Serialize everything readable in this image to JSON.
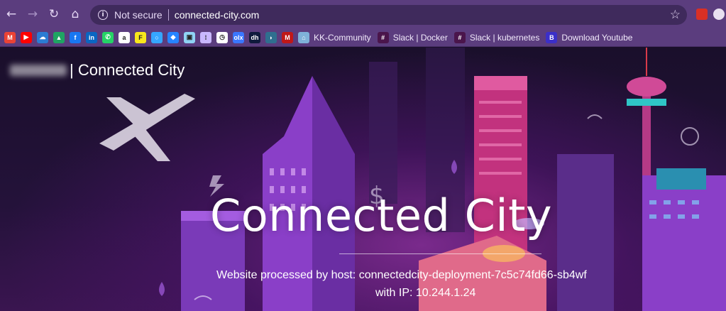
{
  "browser": {
    "back_glyph": "←",
    "forward_glyph": "→",
    "reload_glyph": "↻",
    "home_glyph": "⌂",
    "info_glyph": "i",
    "security_label": "Not secure",
    "url": "connected-city.com",
    "star_glyph": "☆",
    "accent_color": "#5b3d7e"
  },
  "bookmarks": {
    "icons": [
      {
        "name": "gmail-icon",
        "color": "#ea4335",
        "glyph": "M"
      },
      {
        "name": "youtube-icon",
        "color": "#ff0000",
        "glyph": "▶"
      },
      {
        "name": "onedrive-icon",
        "color": "#2b7cd3",
        "glyph": "☁"
      },
      {
        "name": "google-drive-icon",
        "color": "#1fa463",
        "glyph": "▲"
      },
      {
        "name": "facebook-icon",
        "color": "#1877f2",
        "glyph": "f"
      },
      {
        "name": "linkedin-icon",
        "color": "#0a66c2",
        "glyph": "in"
      },
      {
        "name": "whatsapp-icon",
        "color": "#25d366",
        "glyph": "✆"
      },
      {
        "name": "amazon-icon",
        "color": "#ffffff",
        "glyph": "a"
      },
      {
        "name": "flipkart-icon",
        "color": "#f8e71c",
        "glyph": "F"
      },
      {
        "name": "circle-app-icon",
        "color": "#35a7ff",
        "glyph": "○"
      },
      {
        "name": "jira-icon",
        "color": "#2684ff",
        "glyph": "◆"
      },
      {
        "name": "tool-icon",
        "color": "#8fd3f4",
        "glyph": "▣"
      },
      {
        "name": "grid-app-icon",
        "color": "#c9b8ff",
        "glyph": "⁞"
      },
      {
        "name": "clock-app-icon",
        "color": "#ffffff",
        "glyph": "◷"
      },
      {
        "name": "olx-icon",
        "color": "#3a77ff",
        "glyph": "olx"
      },
      {
        "name": "dh-icon",
        "color": "#0f1a3c",
        "glyph": "dh"
      },
      {
        "name": "hat-icon",
        "color": "#2f6f8f",
        "glyph": "◗"
      },
      {
        "name": "mcafee-icon",
        "color": "#c01818",
        "glyph": "M"
      }
    ],
    "items": [
      {
        "label": "KK-Community",
        "icon": "home-bookmark-icon",
        "color": "#7fb2d9",
        "glyph": "⌂"
      },
      {
        "label": "Slack | Docker",
        "icon": "slack-icon",
        "color": "#4a154b",
        "glyph": "#"
      },
      {
        "label": "Slack | kubernetes",
        "icon": "slack-icon",
        "color": "#4a154b",
        "glyph": "#"
      },
      {
        "label": "Download Youtube",
        "icon": "b-bookmark-icon",
        "color": "#3b2fc9",
        "glyph": "B"
      }
    ]
  },
  "page": {
    "brand_suffix": "| Connected City",
    "hero_title": "Connected City",
    "host_line": "Website processed by host: connectedcity-deployment-7c5c74fd66-sb4wf",
    "ip_line": "with IP: 10.244.1.24"
  }
}
